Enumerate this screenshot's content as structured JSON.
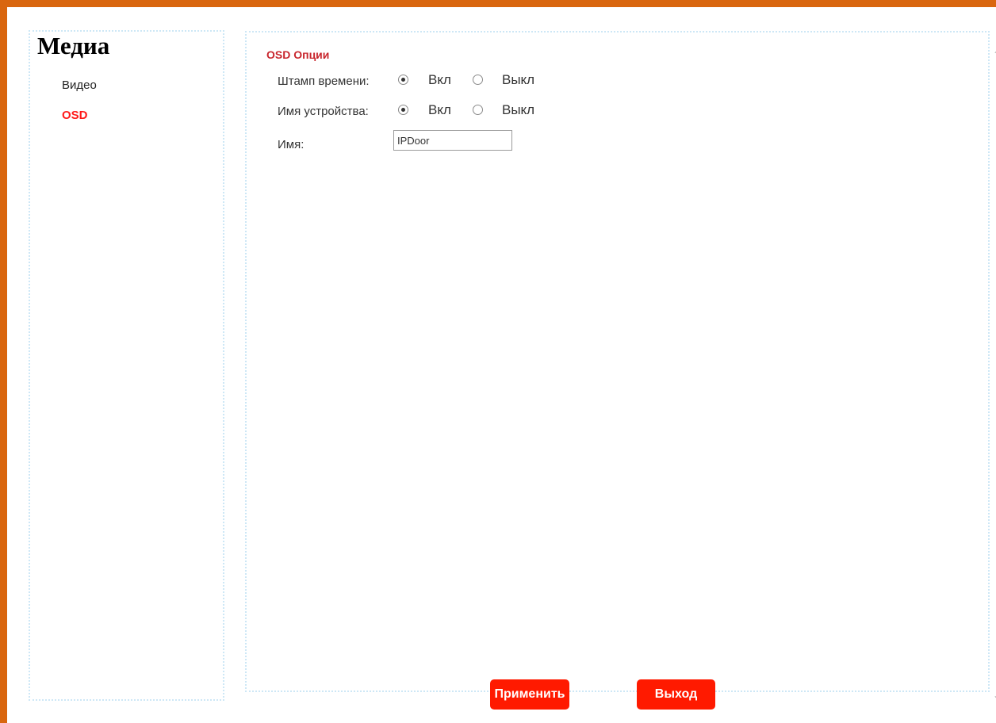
{
  "sidebar": {
    "title": "Медиа",
    "items": [
      {
        "label": "Видео",
        "active": false
      },
      {
        "label": "OSD",
        "active": true
      }
    ]
  },
  "main": {
    "section_title": "OSD Опции",
    "timestamp": {
      "label": "Штамп времени:",
      "on_label": "Вкл",
      "off_label": "Выкл",
      "selected": "Вкл"
    },
    "device_name": {
      "label": "Имя устройства:",
      "on_label": "Вкл",
      "off_label": "Выкл",
      "selected": "Вкл"
    },
    "name": {
      "label": "Имя:",
      "value": "IPDoor"
    }
  },
  "buttons": {
    "apply_label": "Применить",
    "exit_label": "Выход"
  },
  "colors": {
    "frame": "#d9660f",
    "accent_red": "#ff1a00",
    "section_title": "#c8262d",
    "panel_border": "#cde7f6"
  },
  "icons": {
    "scroll_up": "chevron-up-icon",
    "scroll_down": "chevron-down-icon"
  }
}
